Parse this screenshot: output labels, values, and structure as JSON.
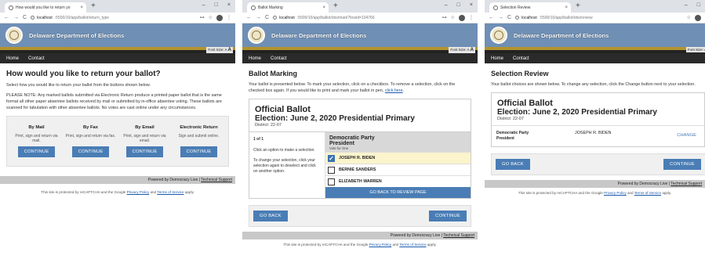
{
  "browser": {
    "windows": [
      {
        "tab_title": "How would you like to return yo",
        "url_host": "localhost",
        "url_path": ":5500/10/app/ballot/return_type"
      },
      {
        "tab_title": "Ballot Marking",
        "url_host": "localhost",
        "url_path": ":5500/10/app/ballot/obs/mark?boxid=104766"
      },
      {
        "tab_title": "Selection Review",
        "url_host": "localhost",
        "url_path": ":5500/10/app/ballot/obs/review"
      }
    ],
    "controls": {
      "back": "←",
      "forward": "→",
      "reload": "C",
      "new_tab": "+",
      "minimize": "–",
      "maximize": "□",
      "close": "×",
      "tab_close": "×",
      "key": "⊶",
      "star": "☆",
      "menu": "⋮"
    }
  },
  "site": {
    "title": "Delaware Department of Elections",
    "font_size_label": "Font Size:",
    "font_size_small": "A",
    "font_size_large": "A",
    "menu": {
      "home": "Home",
      "contact": "Contact"
    },
    "powered_by": "Powered by Democracy Live |",
    "technical_support": "Technical Support",
    "recaptcha": {
      "prefix": "This site is protected by reCAPTCHA and the Google",
      "privacy": "Privacy Policy",
      "and": "and",
      "terms": "Terms of Service",
      "suffix": "apply."
    }
  },
  "page1": {
    "heading": "How would you like to return your ballot?",
    "intro": "Select how you would like to return your ballot from the buttons shown below.",
    "notice": "PLEASE NOTE: Any marked ballots submitted via Electronic Return produce a printed paper ballot that is the same format all other paper absentee ballots received by mail or submitted by in-office absentee voting. These ballots are scanned for tabulation with other absentee ballots. No votes are cast online under any circumstances.",
    "options": [
      {
        "title": "By Mail",
        "desc": "Print, sign and return via mail.",
        "button": "CONTINUE"
      },
      {
        "title": "By Fax",
        "desc": "Print, sign and return via fax.",
        "button": "CONTINUE"
      },
      {
        "title": "By Email",
        "desc": "Print, sign and return via email.",
        "button": "CONTINUE"
      },
      {
        "title": "Electronic Return",
        "desc": "Sign and submit online.",
        "button": "CONTINUE"
      }
    ]
  },
  "page2": {
    "heading": "Ballot Marking",
    "intro": "Your ballot is presented below. To mark your selection, click on a checkbox. To remove a selection, click on the checked box again. If you would like to print and mark your ballot in pen,",
    "intro_link": "click here",
    "ballot_title": "Official Ballot",
    "election": "Election: June 2, 2020 Presidential Primary",
    "district": "District: 22-07",
    "page_count": "1 of 1",
    "help1": "Click an option to make a selection.",
    "help2": "To change your selection, click your selection again to deselect and click on another option.",
    "party": "Democratic Party",
    "office": "President",
    "vote_for": "Vote for One",
    "candidates": [
      "JOSEPH R. BIDEN",
      "BERNIE SANDERS",
      "ELIZABETH WARREN"
    ],
    "selected_check": "✓",
    "review_button": "GO BACK TO REVIEW PAGE",
    "go_back": "GO BACK",
    "continue": "CONTINUE"
  },
  "page3": {
    "heading": "Selection Review",
    "intro": "Your ballot choices are shown below. To change any selection, click the Change button next to your selection.",
    "ballot_title": "Official Ballot",
    "election": "Election: June 2, 2020 Presidential Primary",
    "district": "District: 22-07",
    "party": "Democratic Party",
    "office": "President",
    "choice": "JOSEPH R. BIDEN",
    "change": "CHANGE",
    "go_back": "GO BACK",
    "continue": "CONTINUE"
  }
}
